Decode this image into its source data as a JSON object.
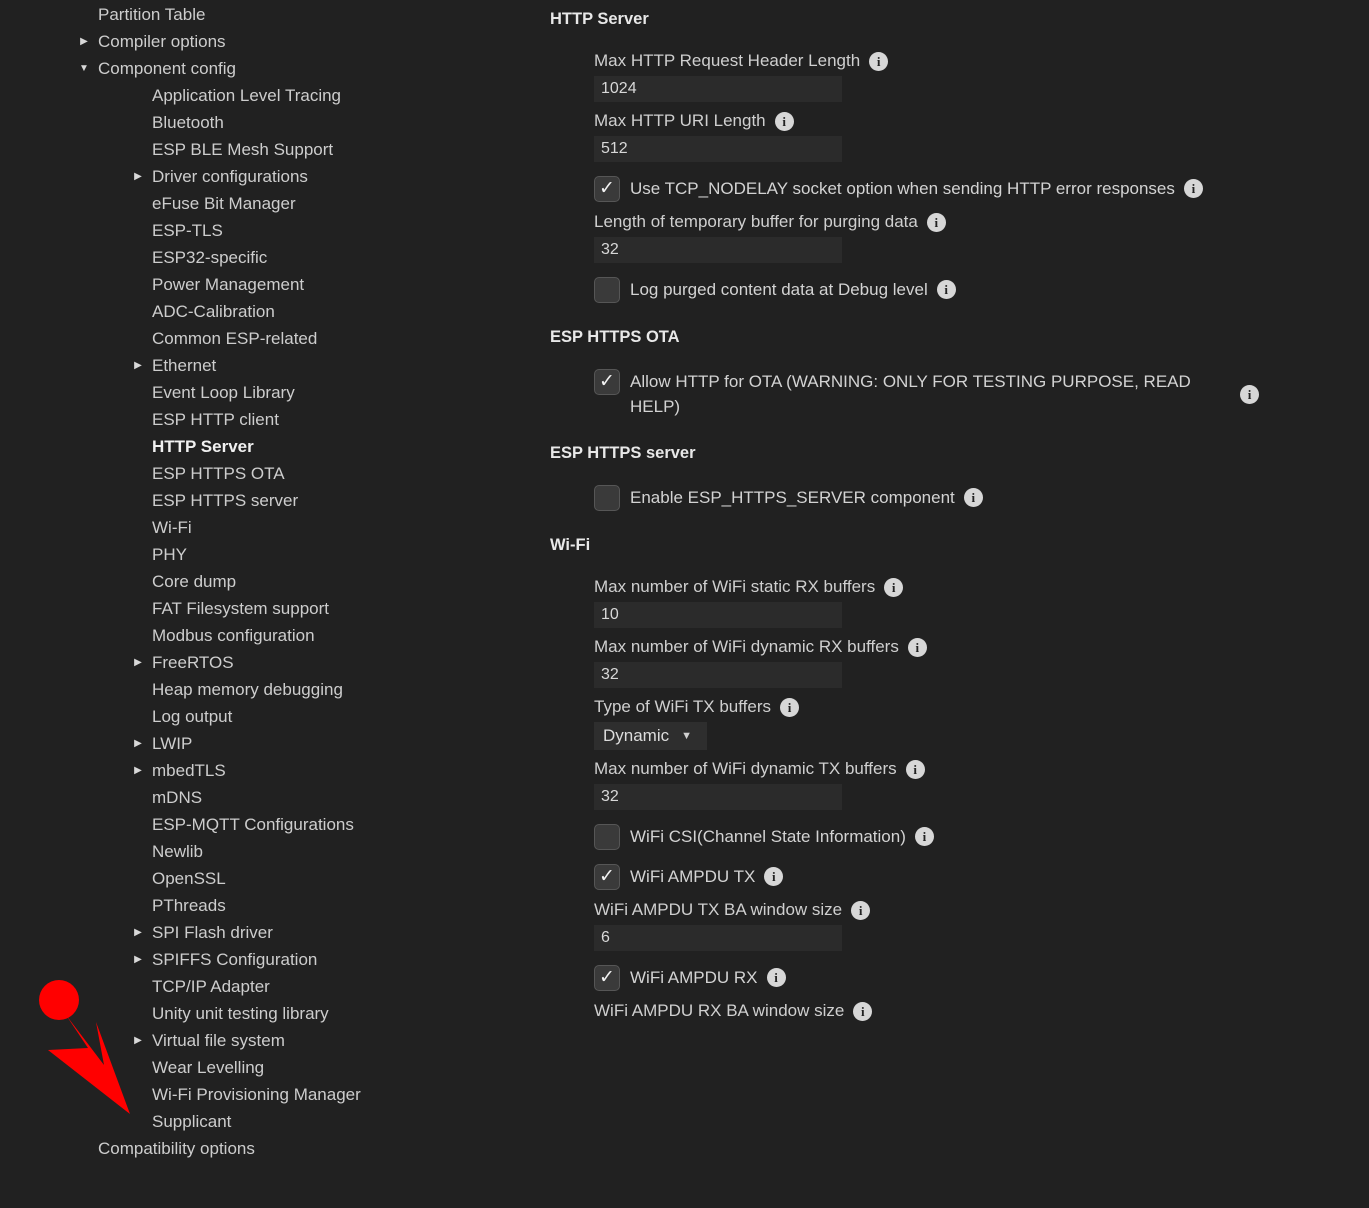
{
  "sidebar": {
    "items": [
      {
        "label": "Partition Table",
        "indent": 0,
        "arrow": "none",
        "selected": false
      },
      {
        "label": "Compiler options",
        "indent": 1,
        "arrow": "collapsed",
        "selected": false
      },
      {
        "label": "Component config",
        "indent": 1,
        "arrow": "expanded",
        "selected": false
      },
      {
        "label": "Application Level Tracing",
        "indent": 2,
        "arrow": "none",
        "selected": false
      },
      {
        "label": "Bluetooth",
        "indent": 2,
        "arrow": "none",
        "selected": false
      },
      {
        "label": "ESP BLE Mesh Support",
        "indent": 2,
        "arrow": "none",
        "selected": false
      },
      {
        "label": "Driver configurations",
        "indent": 3,
        "arrow": "collapsed",
        "selected": false
      },
      {
        "label": "eFuse Bit Manager",
        "indent": 2,
        "arrow": "none",
        "selected": false
      },
      {
        "label": "ESP-TLS",
        "indent": 2,
        "arrow": "none",
        "selected": false
      },
      {
        "label": "ESP32-specific",
        "indent": 2,
        "arrow": "none",
        "selected": false
      },
      {
        "label": "Power Management",
        "indent": 2,
        "arrow": "none",
        "selected": false
      },
      {
        "label": "ADC-Calibration",
        "indent": 2,
        "arrow": "none",
        "selected": false
      },
      {
        "label": "Common ESP-related",
        "indent": 2,
        "arrow": "none",
        "selected": false
      },
      {
        "label": "Ethernet",
        "indent": 3,
        "arrow": "collapsed",
        "selected": false
      },
      {
        "label": "Event Loop Library",
        "indent": 2,
        "arrow": "none",
        "selected": false
      },
      {
        "label": "ESP HTTP client",
        "indent": 2,
        "arrow": "none",
        "selected": false
      },
      {
        "label": "HTTP Server",
        "indent": 2,
        "arrow": "none",
        "selected": true
      },
      {
        "label": "ESP HTTPS OTA",
        "indent": 2,
        "arrow": "none",
        "selected": false
      },
      {
        "label": "ESP HTTPS server",
        "indent": 2,
        "arrow": "none",
        "selected": false
      },
      {
        "label": "Wi-Fi",
        "indent": 2,
        "arrow": "none",
        "selected": false
      },
      {
        "label": "PHY",
        "indent": 2,
        "arrow": "none",
        "selected": false
      },
      {
        "label": "Core dump",
        "indent": 2,
        "arrow": "none",
        "selected": false
      },
      {
        "label": "FAT Filesystem support",
        "indent": 2,
        "arrow": "none",
        "selected": false
      },
      {
        "label": "Modbus configuration",
        "indent": 2,
        "arrow": "none",
        "selected": false
      },
      {
        "label": "FreeRTOS",
        "indent": 3,
        "arrow": "collapsed",
        "selected": false
      },
      {
        "label": "Heap memory debugging",
        "indent": 2,
        "arrow": "none",
        "selected": false
      },
      {
        "label": "Log output",
        "indent": 2,
        "arrow": "none",
        "selected": false
      },
      {
        "label": "LWIP",
        "indent": 3,
        "arrow": "collapsed",
        "selected": false
      },
      {
        "label": "mbedTLS",
        "indent": 3,
        "arrow": "collapsed",
        "selected": false
      },
      {
        "label": "mDNS",
        "indent": 2,
        "arrow": "none",
        "selected": false
      },
      {
        "label": "ESP-MQTT Configurations",
        "indent": 2,
        "arrow": "none",
        "selected": false
      },
      {
        "label": "Newlib",
        "indent": 2,
        "arrow": "none",
        "selected": false
      },
      {
        "label": "OpenSSL",
        "indent": 2,
        "arrow": "none",
        "selected": false
      },
      {
        "label": "PThreads",
        "indent": 2,
        "arrow": "none",
        "selected": false
      },
      {
        "label": "SPI Flash driver",
        "indent": 3,
        "arrow": "collapsed",
        "selected": false
      },
      {
        "label": "SPIFFS Configuration",
        "indent": 3,
        "arrow": "collapsed",
        "selected": false
      },
      {
        "label": "TCP/IP Adapter",
        "indent": 2,
        "arrow": "none",
        "selected": false
      },
      {
        "label": "Unity unit testing library",
        "indent": 2,
        "arrow": "none",
        "selected": false
      },
      {
        "label": "Virtual file system",
        "indent": 3,
        "arrow": "collapsed",
        "selected": false
      },
      {
        "label": "Wear Levelling",
        "indent": 2,
        "arrow": "none",
        "selected": false
      },
      {
        "label": "Wi-Fi Provisioning Manager",
        "indent": 2,
        "arrow": "none",
        "selected": false
      },
      {
        "label": "Supplicant",
        "indent": 2,
        "arrow": "none",
        "selected": false
      },
      {
        "label": "Compatibility options",
        "indent": 0,
        "arrow": "none",
        "selected": false
      }
    ],
    "arrow_glyphs": {
      "collapsed": "▶",
      "expanded": "▼"
    }
  },
  "config": {
    "sections": [
      {
        "title": "HTTP Server",
        "rows": [
          {
            "kind": "label",
            "text": "Max HTTP Request Header Length",
            "info": true
          },
          {
            "kind": "input",
            "value": "1024"
          },
          {
            "kind": "label",
            "text": "Max HTTP URI Length",
            "info": true
          },
          {
            "kind": "input",
            "value": "512"
          },
          {
            "kind": "check",
            "text": "Use TCP_NODELAY socket option when sending HTTP error responses",
            "checked": true,
            "info": true
          },
          {
            "kind": "label",
            "text": "Length of temporary buffer for purging data",
            "info": true
          },
          {
            "kind": "input",
            "value": "32"
          },
          {
            "kind": "check",
            "text": "Log purged content data at Debug level",
            "checked": false,
            "info": true
          }
        ]
      },
      {
        "title": "ESP HTTPS OTA",
        "rows": [
          {
            "kind": "check-wrap",
            "text": "Allow HTTP for OTA (WARNING: ONLY FOR TESTING PURPOSE, READ HELP)",
            "checked": true,
            "info": true
          }
        ]
      },
      {
        "title": "ESP HTTPS server",
        "rows": [
          {
            "kind": "check",
            "text": "Enable ESP_HTTPS_SERVER component",
            "checked": false,
            "info": true
          }
        ]
      },
      {
        "title": "Wi-Fi",
        "rows": [
          {
            "kind": "label",
            "text": "Max number of WiFi static RX buffers",
            "info": true
          },
          {
            "kind": "input",
            "value": "10"
          },
          {
            "kind": "label",
            "text": "Max number of WiFi dynamic RX buffers",
            "info": true
          },
          {
            "kind": "input",
            "value": "32"
          },
          {
            "kind": "label",
            "text": "Type of WiFi TX buffers",
            "info": true
          },
          {
            "kind": "select",
            "value": "Dynamic",
            "caret": "▼"
          },
          {
            "kind": "label",
            "text": "Max number of WiFi dynamic TX buffers",
            "info": true
          },
          {
            "kind": "input",
            "value": "32"
          },
          {
            "kind": "check",
            "text": "WiFi CSI(Channel State Information)",
            "checked": false,
            "info": true
          },
          {
            "kind": "check",
            "text": "WiFi AMPDU TX",
            "checked": true,
            "info": true
          },
          {
            "kind": "label",
            "text": "WiFi AMPDU TX BA window size",
            "info": true
          },
          {
            "kind": "input",
            "value": "6"
          },
          {
            "kind": "check",
            "text": "WiFi AMPDU RX",
            "checked": true,
            "info": true
          },
          {
            "kind": "label",
            "text": "WiFi AMPDU RX BA window size",
            "info": true
          }
        ]
      }
    ],
    "info_glyph": "i"
  },
  "annotation": {
    "arrow_color": "#FF0000",
    "points_at": "Supplicant"
  }
}
